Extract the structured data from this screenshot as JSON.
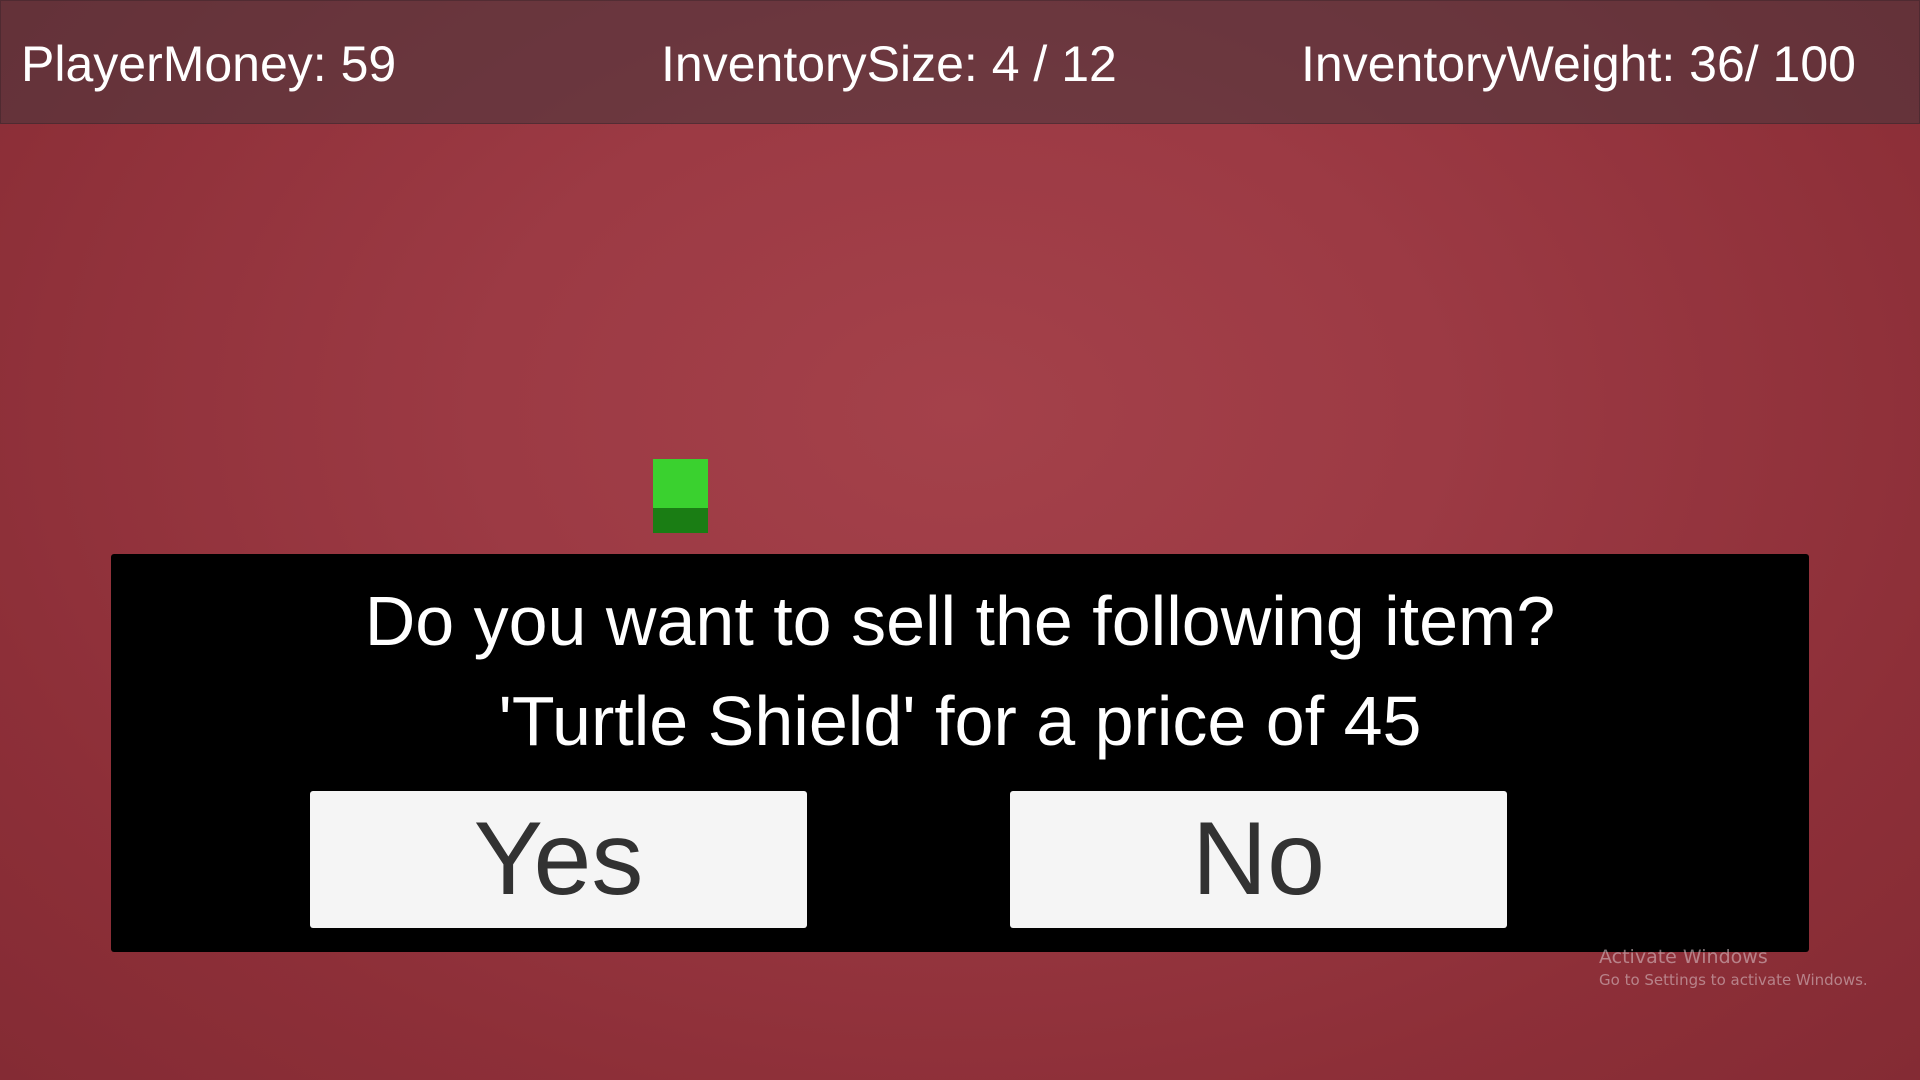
{
  "hud": {
    "player_money": "PlayerMoney: 59",
    "inventory_size": "InventorySize: 4 / 12",
    "inventory_weight": "InventoryWeight: 36/ 100"
  },
  "item": {
    "icon": "green-item-icon",
    "color_top": "#3ad12f",
    "color_bottom": "#1a7d14"
  },
  "dialog": {
    "question": "Do you want to sell the following item?",
    "item_line": "'Turtle Shield' for a price of 45",
    "yes_label": "Yes",
    "no_label": "No"
  },
  "watermark": {
    "title": "Activate Windows",
    "subtitle": "Go to Settings to activate Windows."
  },
  "colors": {
    "background": "#9c3a44",
    "dialog_bg": "#000000",
    "button_bg": "#f5f5f5",
    "button_text": "#323232"
  }
}
